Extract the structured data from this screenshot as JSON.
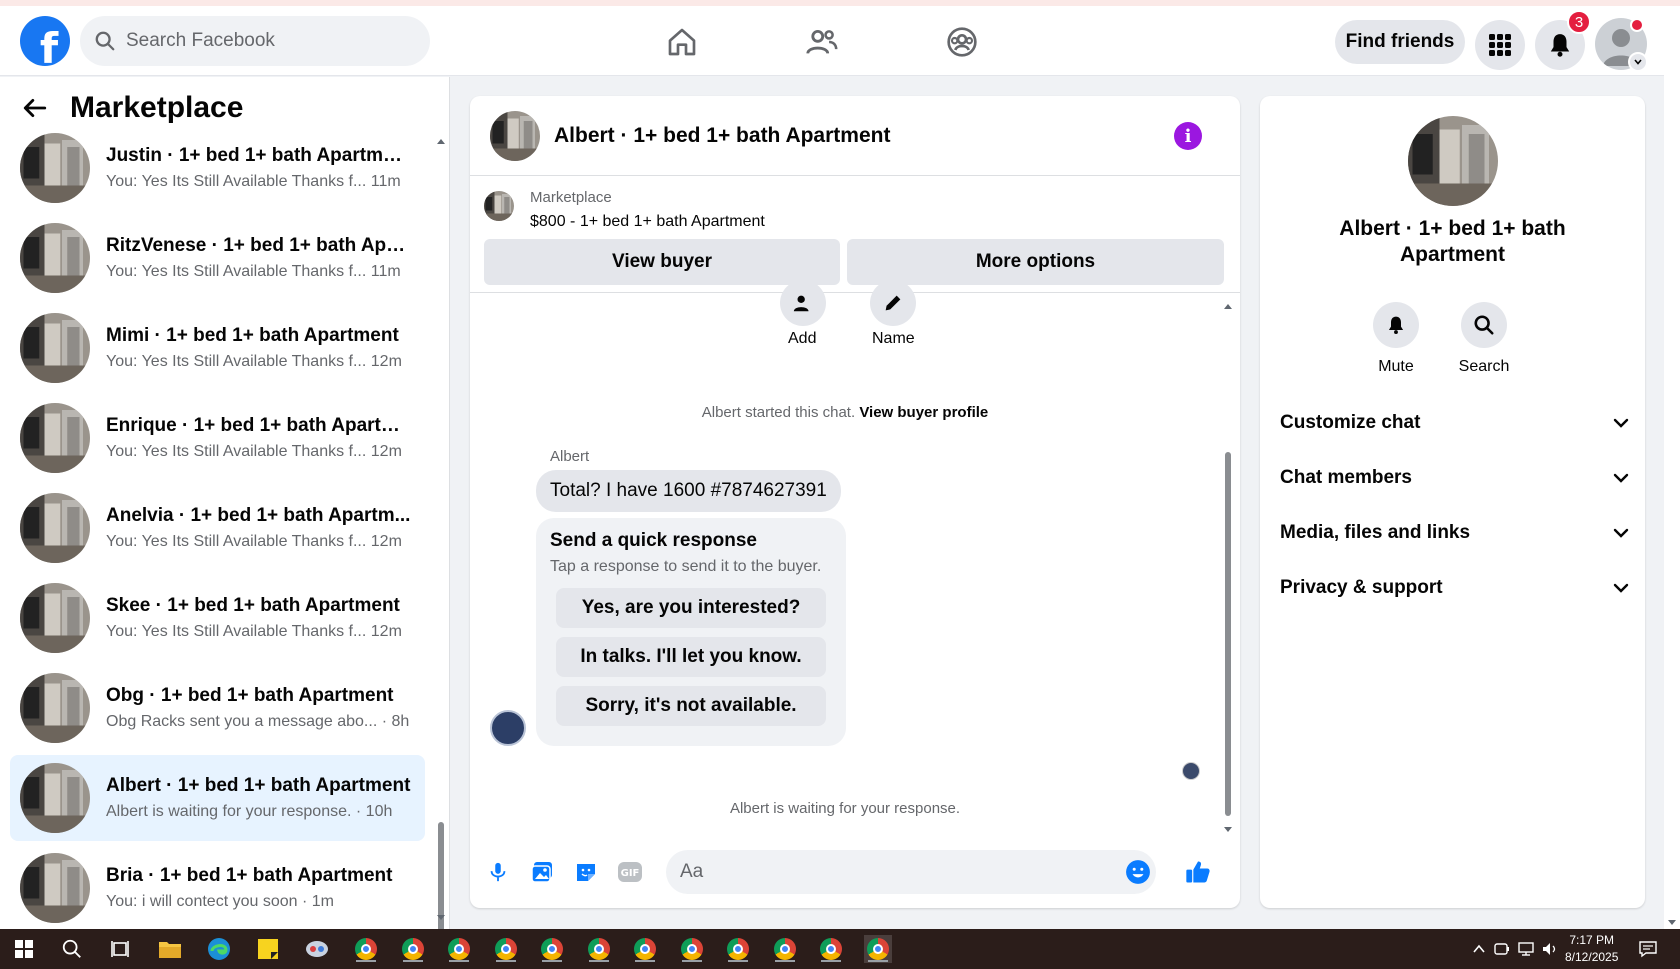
{
  "topbar": {
    "search_placeholder": "Search Facebook",
    "find_friends_label": "Find friends",
    "notifications_count": "3"
  },
  "left": {
    "title": "Marketplace",
    "conversations": [
      {
        "title": "Justin · 1+ bed 1+ bath Apartment",
        "preview": "You: Yes Its Still Available Thanks f...",
        "time": "11m"
      },
      {
        "title": "RitzVenese · 1+ bed 1+ bath Apa...",
        "preview": "You: Yes Its Still Available Thanks f...",
        "time": "11m"
      },
      {
        "title": "Mimi · 1+ bed 1+ bath Apartment",
        "preview": "You: Yes Its Still Available Thanks f...",
        "time": "12m"
      },
      {
        "title": "Enrique · 1+ bed 1+ bath Apartm...",
        "preview": "You: Yes Its Still Available Thanks f...",
        "time": "12m"
      },
      {
        "title": "Anelvia · 1+ bed 1+ bath Apartm...",
        "preview": "You: Yes Its Still Available Thanks f...",
        "time": "12m"
      },
      {
        "title": "Skee · 1+ bed 1+ bath Apartment",
        "preview": "You: Yes Its Still Available Thanks f...",
        "time": "12m"
      },
      {
        "title": "Obg · 1+ bed 1+ bath Apartment",
        "preview": "Obg Racks sent you a message abo... ·",
        "time": "8h"
      },
      {
        "title": "Albert · 1+ bed 1+ bath Apartment",
        "preview": "Albert is waiting for your response. ·",
        "time": "10h"
      },
      {
        "title": "Bria · 1+ bed 1+ bath Apartment",
        "preview": "You: i will contect you soon ·",
        "time": "1m"
      }
    ]
  },
  "chat": {
    "title": "Albert · 1+ bed 1+ bath Apartment",
    "listing_label": "Marketplace",
    "listing_price": "$800 - 1+ bed 1+ bath Apartment",
    "view_buyer_label": "View buyer",
    "more_options_label": "More options",
    "add_label": "Add",
    "name_label": "Name",
    "started_text": "Albert started this chat.",
    "view_buyer_profile": "View buyer profile",
    "sender_name": "Albert",
    "message": "Total? I have 1600 #7874627391",
    "quick_title": "Send a quick response",
    "quick_sub": "Tap a response to send it to the buyer.",
    "quick_responses": [
      "Yes, are you interested?",
      "In talks. I'll let you know.",
      "Sorry, it's not available."
    ],
    "waiting_text": "Albert is waiting for your response.",
    "input_placeholder": "Aa"
  },
  "right": {
    "title": "Albert · 1+ bed 1+ bath Apartment",
    "mute_label": "Mute",
    "search_label": "Search",
    "rows": [
      "Customize chat",
      "Chat members",
      "Media, files and links",
      "Privacy & support"
    ]
  },
  "taskbar": {
    "time": "7:17 PM",
    "date": "8/12/2025"
  }
}
